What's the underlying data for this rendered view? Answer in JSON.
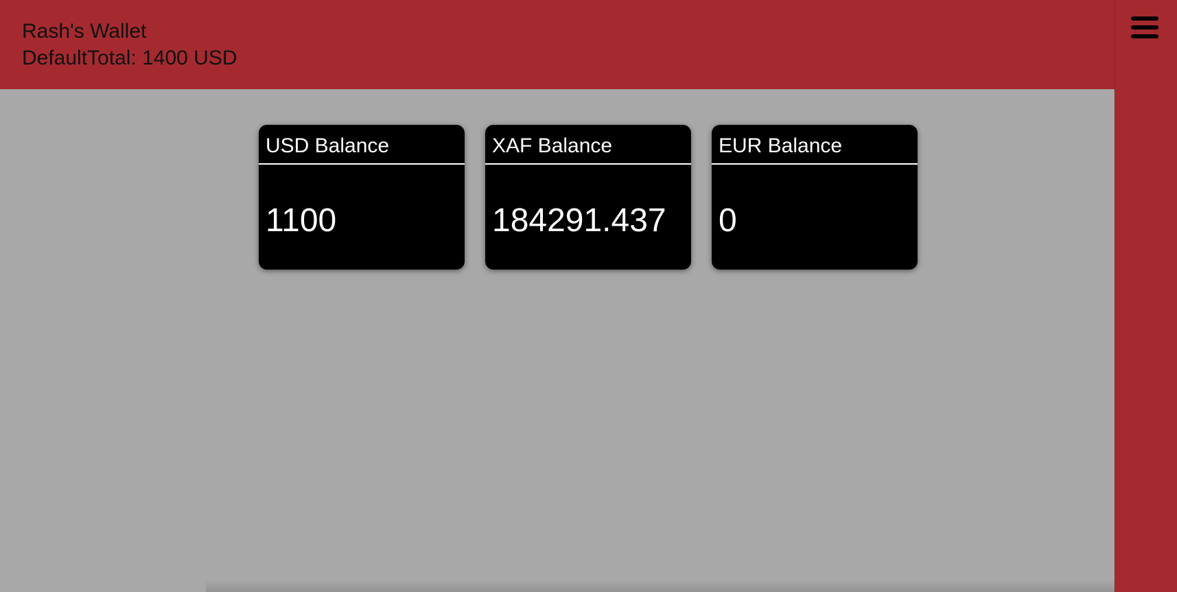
{
  "header": {
    "title": "Rash's Wallet",
    "subtitle": "DefaultTotal: 1400 USD"
  },
  "menu": {
    "icon": "hamburger-menu-icon"
  },
  "balances": [
    {
      "label": "USD Balance",
      "value": "1100"
    },
    {
      "label": "XAF Balance",
      "value": "184291.437"
    },
    {
      "label": "EUR Balance",
      "value": "0"
    }
  ],
  "colors": {
    "header_bg": "#a52a30",
    "content_bg": "#a8a8a8",
    "card_bg": "#000000",
    "card_text": "#ffffff"
  }
}
